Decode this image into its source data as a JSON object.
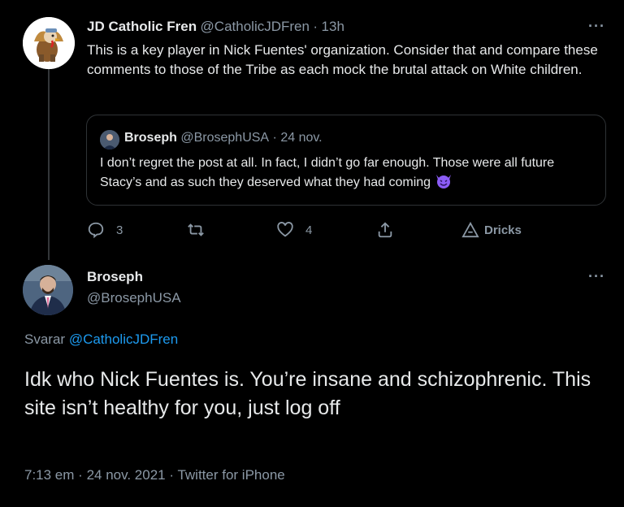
{
  "parent_tweet": {
    "author_name": "JD Catholic Fren",
    "author_handle": "@CatholicJDFren",
    "separator": "·",
    "time": "13h",
    "more": "···",
    "text": "This is a key player in Nick Fuentes' organization. Consider that and compare these comments to those of the Tribe as each mock the brutal attack on White children.",
    "quote": {
      "author_name": "Broseph",
      "author_handle": "@BrosephUSA",
      "separator": "·",
      "date": "24 nov.",
      "text": "I don’t regret the post at all. In fact, I didn’t go far enough. Those were all future Stacy’s and as such they deserved what they had coming",
      "emoji_icon": "smiling-devil-icon"
    },
    "actions": {
      "reply_count": "3",
      "retweet_count": "",
      "like_count": "4",
      "tip_label": "Dricks"
    }
  },
  "main_tweet": {
    "author_name": "Broseph",
    "author_handle": "@BrosephUSA",
    "more": "···",
    "replying_label": "Svarar",
    "replying_to": "@CatholicJDFren",
    "text": "Idk who Nick Fuentes is. You’re insane and schizophrenic. This site isn’t healthy for you, just log off",
    "time": "7:13 em",
    "dot1": "·",
    "date": "24 nov. 2021",
    "dot2": "·",
    "source": "Twitter for iPhone"
  },
  "colors": {
    "background": "#000000",
    "text": "#e7e9ea",
    "muted": "#8b98a5",
    "link": "#1d9bf0",
    "border": "#2f3336",
    "devil_emoji": "#8b5cf6"
  }
}
